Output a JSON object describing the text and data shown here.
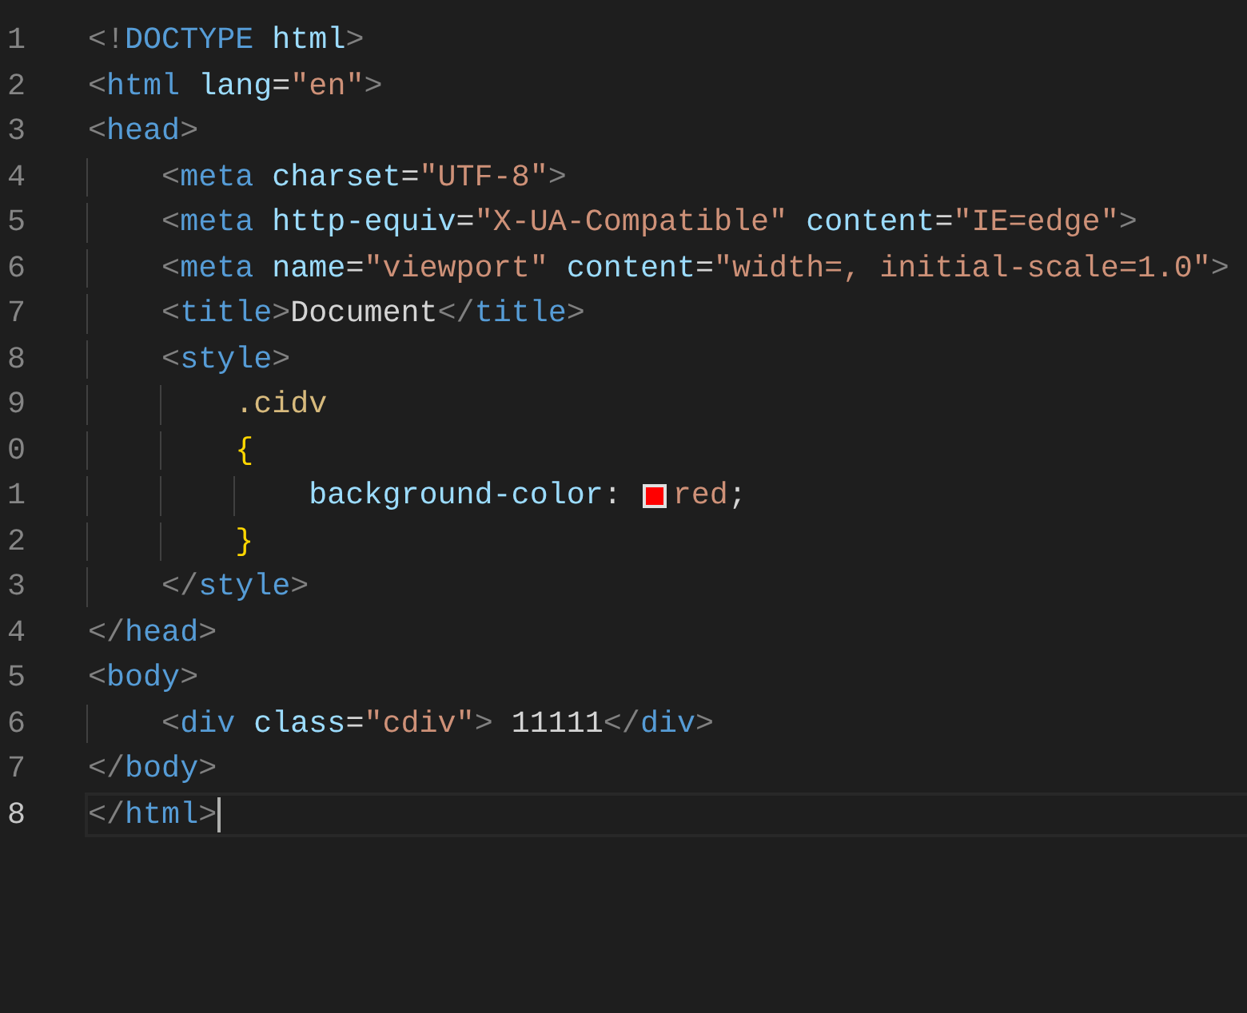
{
  "editor": {
    "lines": [
      {
        "number": "1",
        "current": false,
        "tokens": [
          {
            "kind": "punct",
            "text": "<!"
          },
          {
            "kind": "tag",
            "text": "DOCTYPE"
          },
          {
            "kind": "attr",
            "text": " html"
          },
          {
            "kind": "punct",
            "text": ">"
          }
        ]
      },
      {
        "number": "2",
        "current": false,
        "tokens": [
          {
            "kind": "punct",
            "text": "<"
          },
          {
            "kind": "tag",
            "text": "html"
          },
          {
            "kind": "attr",
            "text": " lang"
          },
          {
            "kind": "text",
            "text": "="
          },
          {
            "kind": "string",
            "text": "\"en\""
          },
          {
            "kind": "punct",
            "text": ">"
          }
        ]
      },
      {
        "number": "3",
        "current": false,
        "tokens": [
          {
            "kind": "punct",
            "text": "<"
          },
          {
            "kind": "tag",
            "text": "head"
          },
          {
            "kind": "punct",
            "text": ">"
          }
        ]
      },
      {
        "number": "4",
        "current": false,
        "tokens": [
          {
            "kind": "indent"
          },
          {
            "kind": "punct",
            "text": "<"
          },
          {
            "kind": "tag",
            "text": "meta"
          },
          {
            "kind": "attr",
            "text": " charset"
          },
          {
            "kind": "text",
            "text": "="
          },
          {
            "kind": "string",
            "text": "\"UTF-8\""
          },
          {
            "kind": "punct",
            "text": ">"
          }
        ]
      },
      {
        "number": "5",
        "current": false,
        "tokens": [
          {
            "kind": "indent"
          },
          {
            "kind": "punct",
            "text": "<"
          },
          {
            "kind": "tag",
            "text": "meta"
          },
          {
            "kind": "attr",
            "text": " http-equiv"
          },
          {
            "kind": "text",
            "text": "="
          },
          {
            "kind": "string",
            "text": "\"X-UA-Compatible\""
          },
          {
            "kind": "attr",
            "text": " content"
          },
          {
            "kind": "text",
            "text": "="
          },
          {
            "kind": "string",
            "text": "\"IE=edge\""
          },
          {
            "kind": "punct",
            "text": ">"
          }
        ]
      },
      {
        "number": "6",
        "current": false,
        "tokens": [
          {
            "kind": "indent"
          },
          {
            "kind": "punct",
            "text": "<"
          },
          {
            "kind": "tag",
            "text": "meta"
          },
          {
            "kind": "attr",
            "text": " name"
          },
          {
            "kind": "text",
            "text": "="
          },
          {
            "kind": "string",
            "text": "\"viewport\""
          },
          {
            "kind": "attr",
            "text": " content"
          },
          {
            "kind": "text",
            "text": "="
          },
          {
            "kind": "string",
            "text": "\"width=, initial-scale=1.0\""
          },
          {
            "kind": "punct",
            "text": ">"
          }
        ]
      },
      {
        "number": "7",
        "current": false,
        "tokens": [
          {
            "kind": "indent"
          },
          {
            "kind": "punct",
            "text": "<"
          },
          {
            "kind": "tag",
            "text": "title"
          },
          {
            "kind": "punct",
            "text": ">"
          },
          {
            "kind": "text",
            "text": "Document"
          },
          {
            "kind": "punct",
            "text": "</"
          },
          {
            "kind": "tag",
            "text": "title"
          },
          {
            "kind": "punct",
            "text": ">"
          }
        ]
      },
      {
        "number": "8",
        "current": false,
        "tokens": [
          {
            "kind": "indent"
          },
          {
            "kind": "punct",
            "text": "<"
          },
          {
            "kind": "tag",
            "text": "style"
          },
          {
            "kind": "punct",
            "text": ">"
          }
        ]
      },
      {
        "number": "9",
        "current": false,
        "tokens": [
          {
            "kind": "indent"
          },
          {
            "kind": "indent"
          },
          {
            "kind": "selector",
            "text": ".cidv"
          }
        ]
      },
      {
        "number": "0",
        "current": false,
        "tokens": [
          {
            "kind": "indent"
          },
          {
            "kind": "indent"
          },
          {
            "kind": "brace",
            "text": "{"
          }
        ]
      },
      {
        "number": "1",
        "current": false,
        "tokens": [
          {
            "kind": "indent"
          },
          {
            "kind": "indent"
          },
          {
            "kind": "indent"
          },
          {
            "kind": "property",
            "text": "background-color"
          },
          {
            "kind": "text",
            "text": ":"
          },
          {
            "kind": "swatch",
            "color": "#ff0000"
          },
          {
            "kind": "value",
            "text": "red"
          },
          {
            "kind": "text",
            "text": ";"
          }
        ]
      },
      {
        "number": "2",
        "current": false,
        "tokens": [
          {
            "kind": "indent"
          },
          {
            "kind": "indent"
          },
          {
            "kind": "brace",
            "text": "}"
          }
        ]
      },
      {
        "number": "3",
        "current": false,
        "tokens": [
          {
            "kind": "indent"
          },
          {
            "kind": "punct",
            "text": "</"
          },
          {
            "kind": "tag",
            "text": "style"
          },
          {
            "kind": "punct",
            "text": ">"
          }
        ]
      },
      {
        "number": "4",
        "current": false,
        "tokens": [
          {
            "kind": "punct",
            "text": "</"
          },
          {
            "kind": "tag",
            "text": "head"
          },
          {
            "kind": "punct",
            "text": ">"
          }
        ]
      },
      {
        "number": "5",
        "current": false,
        "tokens": [
          {
            "kind": "punct",
            "text": "<"
          },
          {
            "kind": "tag",
            "text": "body"
          },
          {
            "kind": "punct",
            "text": ">"
          }
        ]
      },
      {
        "number": "6",
        "current": false,
        "tokens": [
          {
            "kind": "indent"
          },
          {
            "kind": "punct",
            "text": "<"
          },
          {
            "kind": "tag",
            "text": "div"
          },
          {
            "kind": "attr",
            "text": " class"
          },
          {
            "kind": "text",
            "text": "="
          },
          {
            "kind": "string",
            "text": "\"cdiv\""
          },
          {
            "kind": "punct",
            "text": ">"
          },
          {
            "kind": "text",
            "text": " 11111"
          },
          {
            "kind": "punct",
            "text": "</"
          },
          {
            "kind": "tag",
            "text": "div"
          },
          {
            "kind": "punct",
            "text": ">"
          }
        ]
      },
      {
        "number": "7",
        "current": false,
        "tokens": [
          {
            "kind": "punct",
            "text": "</"
          },
          {
            "kind": "tag",
            "text": "body"
          },
          {
            "kind": "punct",
            "text": ">"
          }
        ]
      },
      {
        "number": "8",
        "current": true,
        "tokens": [
          {
            "kind": "punct",
            "text": "</"
          },
          {
            "kind": "tag",
            "text": "html"
          },
          {
            "kind": "punct",
            "text": ">"
          },
          {
            "kind": "caret"
          }
        ]
      }
    ]
  }
}
